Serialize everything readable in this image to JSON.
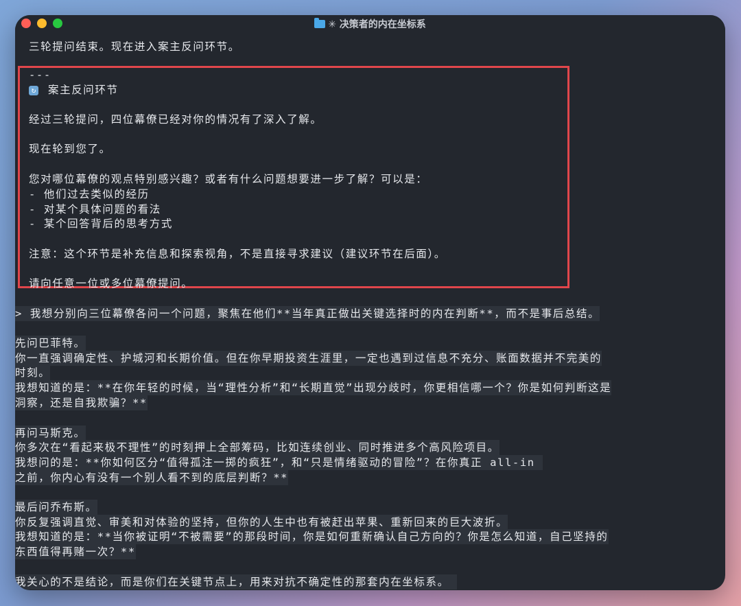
{
  "window": {
    "title": "✳ 决策者的内在坐标系"
  },
  "icons": {
    "folder": "folder-icon",
    "section": "refresh-icon"
  },
  "colors": {
    "terminal_bg": "#23272e",
    "highlight_border": "#e0464b",
    "text": "#e6e8ec"
  },
  "transcript": {
    "intro": "三轮提问结束。现在进入案主反问环节。",
    "box": {
      "divider": "---",
      "section_title": "案主反问环节",
      "p1": "经过三轮提问，四位幕僚已经对你的情况有了深入了解。",
      "p2": "现在轮到您了。",
      "p3": "您对哪位幕僚的观点特别感兴趣？或者有什么问题想要进一步了解？可以是：",
      "bullet1": "- 他们过去类似的经历",
      "bullet2": "- 对某个具体问题的看法",
      "bullet3": "- 某个回答背后的思考方式",
      "note": "注意：这个环节是补充信息和探索视角，不是直接寻求建议（建议环节在后面）。",
      "prompt": "请向任意一位或多位幕僚提问。"
    },
    "user": {
      "l1": "> 我想分别向三位幕僚各问一个问题，聚焦在他们**当年真正做出关键选择时的内在判断**，而不是事后总结。",
      "l2": "先问巴菲特。",
      "l3": "你一直强调确定性、护城河和长期价值。但在你早期投资生涯里，一定也遇到过信息不充分、账面数据并不完美的",
      "l4": "时刻。",
      "l5": "我想知道的是：**在你年轻的时候，当“理性分析”和“长期直觉”出现分歧时，你更相信哪一个？你是如何判断这是",
      "l6": "洞察，还是自我欺骗？**",
      "l7": "再问马斯克。",
      "l8": "你多次在“看起来极不理性”的时刻押上全部筹码，比如连续创业、同时推进多个高风险项目。",
      "l9": "我想问的是：**你如何区分“值得孤注一掷的疯狂”，和“只是情绪驱动的冒险”？在你真正 all-in ",
      "l10": "之前，你内心有没有一个别人看不到的底层判断？**",
      "l11": "最后问乔布斯。",
      "l12": "你反复强调直觉、审美和对体验的坚持，但你的人生中也有被赶出苹果、重新回来的巨大波折。",
      "l13": "我想知道的是：**当你被证明“不被需要”的那段时间，你是如何重新确认自己方向的？你是怎么知道，自己坚持的",
      "l14": "东西值得再赌一次？**",
      "l15": "我关心的不是结论，而是你们在关键节点上，用来对抗不确定性的那套内在坐标系。 "
    }
  }
}
